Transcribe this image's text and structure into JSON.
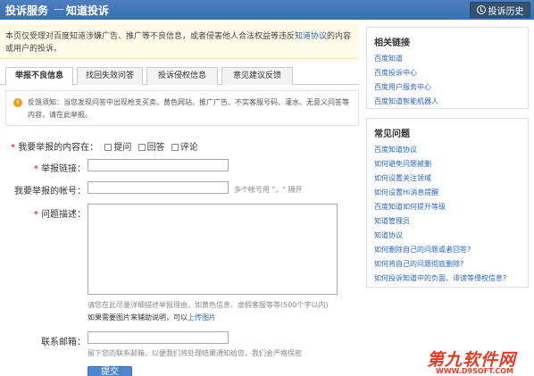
{
  "header": {
    "title": "投诉服务",
    "separator": "—",
    "subtitle": "知道投诉",
    "history_button": "投诉历史"
  },
  "notice": {
    "text_before": "本页仅受理对百度知道涉嫌广告、推广等不良信息，或者侵害他人合法权益等违反",
    "link": "知道协议",
    "text_after": "的内容或用户的投诉。"
  },
  "tabs": [
    {
      "label": "举报不良信息",
      "active": true
    },
    {
      "label": "找回失效问答",
      "active": false
    },
    {
      "label": "投诉侵权信息",
      "active": false
    },
    {
      "label": "意见建议反馈",
      "active": false
    }
  ],
  "hint": {
    "text": "反馈须知：当您发现问答中出现枪支买卖、黄色网站、推广广告、不实客服号码、灌水、无意义问答等内容，请在此举报。"
  },
  "form": {
    "content_in_label": "我要举报的内容在：",
    "options": [
      "提问",
      "回答",
      "评论"
    ],
    "link_label": "举报链接：",
    "account_label": "我要举报的帐号：",
    "account_hint": "多个帐号用 \"，\" 隔开",
    "desc_label": "问题描述：",
    "desc_hint": "请您在此尽量详细描述举报理由，如黄色信息、虚假客服等等(500个字以内)",
    "image_text": "如果需要图片来辅助说明，可以",
    "image_link": "上传图片",
    "email_label": "联系邮箱：",
    "email_hint": "留下您的联系邮箱，以便我们将处理结果通知给您，我们会严格保密",
    "submit_label": "提交"
  },
  "related": {
    "title": "相关链接",
    "items": [
      "百度知道",
      "百度投诉中心",
      "百度用户服务中心",
      "百度知道智能机器人"
    ]
  },
  "faq": {
    "title": "常见问题",
    "items": [
      "百度知道协议",
      "如何避免问题被删",
      "如何设置关注领域",
      "如何设置Hi消息提醒",
      "百度知道如何提升等级",
      "知道管理员",
      "知道协议",
      "如何删除自己的问题或者回答?",
      "如何将自己的问题彻底删除?",
      "如何投诉知道中的负面、诽谤等侵权信息?"
    ]
  },
  "watermark": {
    "title": "第九软件网",
    "url": "WWW.D9SOFT.COM"
  },
  "colors": {
    "header_bg": "#3d6fb0",
    "link": "#2a62b8",
    "required": "#dd0000",
    "notice_bg": "#fffbe8",
    "submit_bg": "#4b86d0"
  }
}
